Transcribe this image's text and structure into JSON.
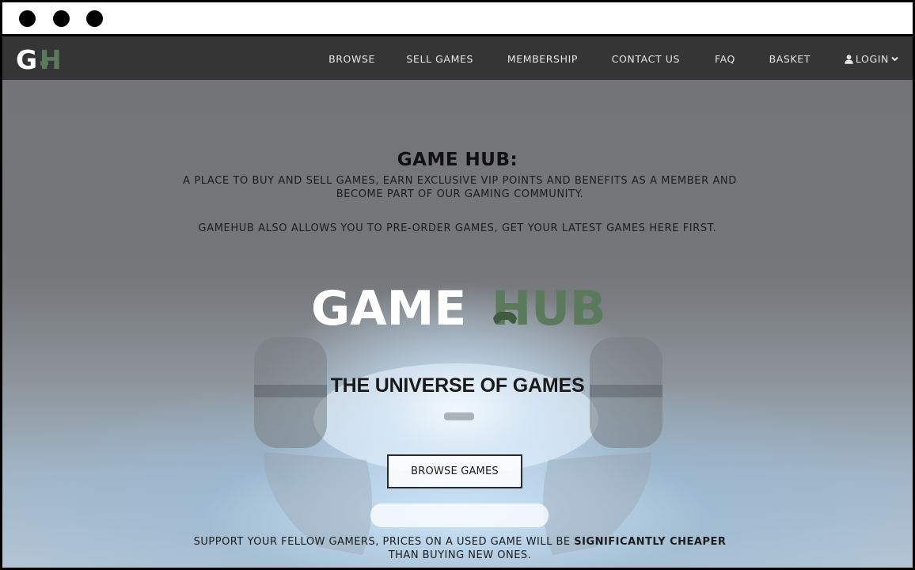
{
  "window": {
    "controls": [
      "close",
      "minimize",
      "maximize"
    ]
  },
  "nav": {
    "logo": {
      "letter_left": "G",
      "letter_right": "H",
      "icon": "gamehub-logo-icon"
    },
    "items": [
      {
        "label": "BROWSE"
      },
      {
        "label": "SELL GAMES"
      },
      {
        "label": "MEMBERSHIP"
      },
      {
        "label": "CONTACT US"
      },
      {
        "label": "FAQ"
      },
      {
        "label": "BASKET"
      }
    ],
    "login": {
      "label": "LOGIN",
      "icon": "user-icon",
      "caret_icon": "chevron-down-icon"
    }
  },
  "hero": {
    "title": "GAME HUB:",
    "description": "A PLACE TO BUY AND SELL GAMES, EARN EXCLUSIVE VIP POINTS AND BENEFITS AS A MEMBER AND BECOME PART OF OUR GAMING COMMUNITY.",
    "preorder": "GAMEHUB ALSO ALLOWS YOU TO PRE-ORDER GAMES, GET YOUR LATEST GAMES HERE FIRST.",
    "logo_word_left": "GAME",
    "logo_word_right": "HUB",
    "tagline": "THE UNIVERSE OF GAMES",
    "cta_label": "BROWSE GAMES",
    "support_prefix": "SUPPORT YOUR FELLOW GAMERS, PRICES ON A USED GAME WILL BE ",
    "support_bold": "SIGNIFICANTLY CHEAPER",
    "support_suffix": "THAN BUYING NEW ONES."
  },
  "colors": {
    "navbar": "#353535",
    "logo_white": "#ffffff",
    "logo_green": "#5b7a5b",
    "hero_text": "#1d1d1d"
  }
}
